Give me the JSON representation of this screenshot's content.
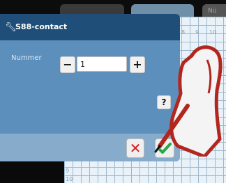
{
  "tabs": [
    "",
    "",
    "Nü"
  ],
  "dialog": {
    "title": "S88-contact",
    "field_label": "Nummer",
    "value": "1",
    "minus_label": "−",
    "plus_label": "+",
    "help_label": "?",
    "cancel_label": "✕"
  },
  "grid": {
    "col_labels": [
      "8",
      "9",
      "10"
    ],
    "row_labels": [
      "9",
      "10"
    ]
  },
  "colors": {
    "title_bar": "#1f4f78",
    "dialog_body": "#5d8fbd",
    "footer": "#86abcb",
    "cancel_red": "#d81c1c",
    "ok_green": "#27a844"
  },
  "icons": [
    "wrench-icon",
    "minus-icon",
    "plus-icon",
    "help-icon",
    "cancel-icon",
    "checkmark-icon",
    "stylus-hand"
  ]
}
